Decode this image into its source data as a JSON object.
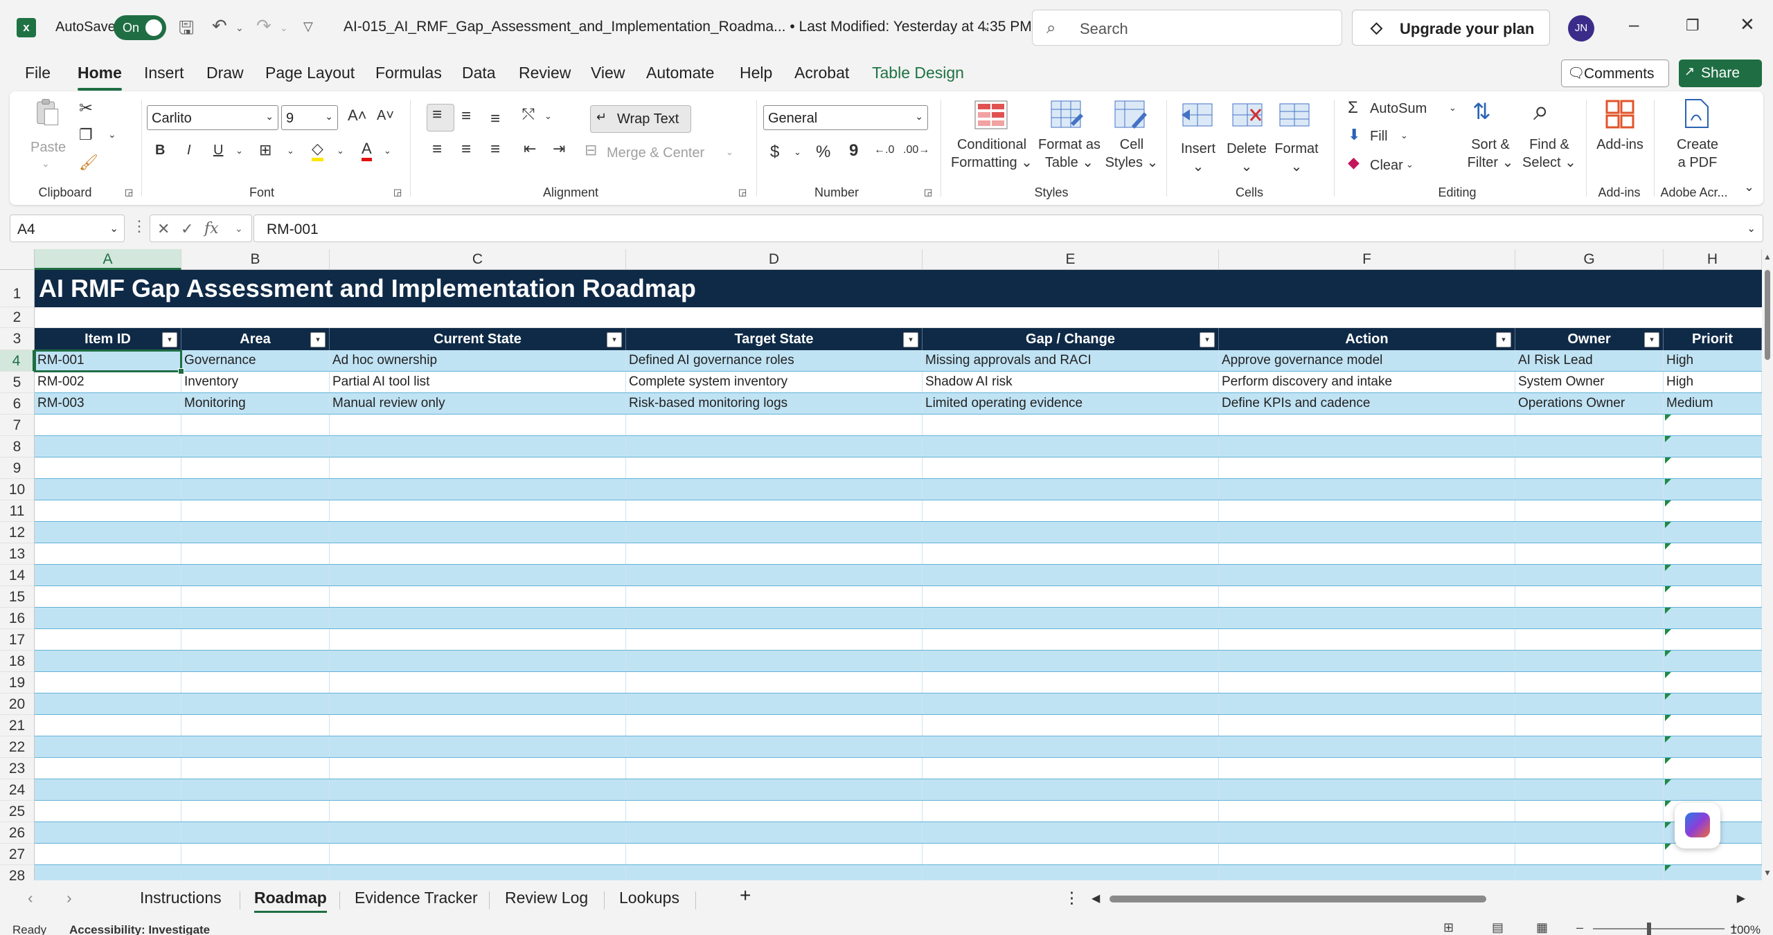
{
  "titlebar": {
    "autosave_label": "AutoSave",
    "autosave_state": "On",
    "document_title": "AI-015_AI_RMF_Gap_Assessment_and_Implementation_Roadma...  •  Last Modified: Yesterday at 4:35 PM",
    "search_placeholder": "Search",
    "upgrade_label": "Upgrade your plan",
    "user_initials": "JN"
  },
  "menu": {
    "tabs": [
      "File",
      "Home",
      "Insert",
      "Draw",
      "Page Layout",
      "Formulas",
      "Data",
      "Review",
      "View",
      "Automate",
      "Help",
      "Acrobat",
      "Table Design"
    ],
    "active_tab": "Home",
    "comments_label": "Comments",
    "share_label": "Share"
  },
  "ribbon": {
    "clipboard": {
      "label": "Clipboard",
      "paste": "Paste"
    },
    "font": {
      "label": "Font",
      "name": "Carlito",
      "size": "9",
      "bold": "B",
      "italic": "I",
      "underline": "U"
    },
    "alignment": {
      "label": "Alignment",
      "wrap_text": "Wrap Text",
      "merge_center": "Merge & Center"
    },
    "number": {
      "label": "Number",
      "format": "General",
      "currency": "$",
      "percent": "%",
      "comma": "9"
    },
    "styles": {
      "label": "Styles",
      "conditional_1": "Conditional",
      "conditional_2": "Formatting",
      "format_table_1": "Format as",
      "format_table_2": "Table",
      "cell_styles_1": "Cell",
      "cell_styles_2": "Styles"
    },
    "cells": {
      "label": "Cells",
      "insert": "Insert",
      "delete": "Delete",
      "format": "Format"
    },
    "editing": {
      "label": "Editing",
      "autosum": "AutoSum",
      "fill": "Fill",
      "clear": "Clear",
      "sort_1": "Sort &",
      "sort_2": "Filter",
      "find_1": "Find &",
      "find_2": "Select"
    },
    "addins": {
      "label": "Add-ins",
      "button": "Add-ins"
    },
    "adobe": {
      "label": "Adobe Acr...",
      "create_1": "Create",
      "create_2": "a PDF"
    }
  },
  "formula_bar": {
    "name_box": "A4",
    "fx": "fx",
    "content": "RM-001"
  },
  "sheet": {
    "columns": [
      "A",
      "B",
      "C",
      "D",
      "E",
      "F",
      "G",
      "H"
    ],
    "selected_column": "A",
    "selected_row": "4",
    "title": "AI RMF Gap Assessment and Implementation Roadmap",
    "headers": [
      "Item ID",
      "Area",
      "Current State",
      "Target State",
      "Gap / Change",
      "Action",
      "Owner",
      "Priorit"
    ],
    "rows": [
      [
        "RM-001",
        "Governance",
        "Ad hoc ownership",
        "Defined AI governance roles",
        "Missing approvals and RACI",
        "Approve governance model",
        "AI Risk Lead",
        "High"
      ],
      [
        "RM-002",
        "Inventory",
        "Partial AI tool list",
        "Complete system inventory",
        "Shadow AI risk",
        "Perform discovery and intake",
        "System Owner",
        "High"
      ],
      [
        "RM-003",
        "Monitoring",
        "Manual review only",
        "Risk-based monitoring logs",
        "Limited operating evidence",
        "Define KPIs and cadence",
        "Operations Owner",
        "Medium"
      ]
    ],
    "row_numbers": [
      "1",
      "2",
      "3",
      "4",
      "5",
      "6",
      "7",
      "8",
      "9",
      "10",
      "11",
      "12",
      "13",
      "14",
      "15",
      "16",
      "17",
      "18",
      "19",
      "20",
      "21",
      "22",
      "23",
      "24",
      "25",
      "26",
      "27",
      "28"
    ]
  },
  "sheet_tabs": {
    "tabs": [
      "Instructions",
      "Roadmap",
      "Evidence Tracker",
      "Review Log",
      "Lookups"
    ],
    "active": "Roadmap"
  },
  "statusbar": {
    "ready": "Ready",
    "accessibility": "Accessibility: Investigate",
    "zoom": "100%"
  },
  "colors": {
    "accent": "#1f6e43",
    "title_fill": "#0f2a47",
    "band_fill": "#c0e3f4"
  }
}
